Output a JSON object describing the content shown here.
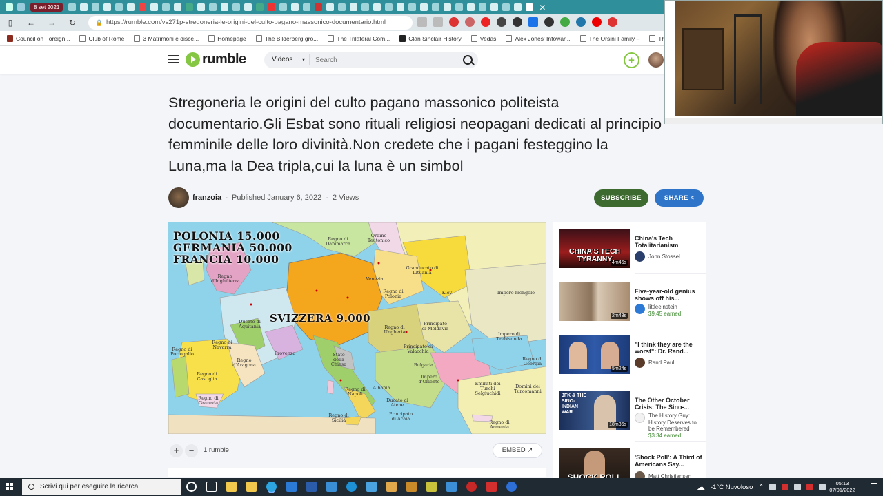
{
  "browser": {
    "active_tab_label": "8 set 2021",
    "url": "https://rumble.com/vs271p-stregoneria-le-origini-del-culto-pagano-massonico-documentario.html",
    "bookmarks": [
      "Council on Foreign...",
      "Club of Rome",
      "3 Matrimoni e disce...",
      "Homepage",
      "The Bilderberg gro...",
      "The Trilateral Com...",
      "Clan Sinclair History",
      "Vedas",
      "Alex Jones' Infowar...",
      "The Orsini Family –",
      "The Coun"
    ]
  },
  "site": {
    "logo_text": "rumble",
    "search_category": "Videos",
    "search_placeholder": "Search",
    "upload_symbol": "+"
  },
  "video": {
    "title": "Stregoneria le origini del culto pagano massonico politeista documentario.Gli Esbat sono rituali religiosi neopagani dedicati al principio femminile delle loro divinità.Non credete che i pagani festeggino la Luna,ma la Dea tripla,cui la luna è un simbol",
    "channel": "franzoia",
    "published": "Published January 6, 2022",
    "views": "2 Views",
    "subscribe_label": "SUBSCRIBE",
    "share_label": "SHARE",
    "rumble_count": "1 rumble",
    "embed_label": "EMBED",
    "frame_caption_lines": [
      "POLONIA 15.000",
      "GERMANIA 50.000",
      "FRANCIA 10.000"
    ],
    "frame_caption_center": "SVIZZERA 9.000",
    "map_labels": [
      "Regno di Danimarca",
      "Ordine Teutonico",
      "Granducato di Lituania",
      "Regno di Polonia",
      "Impero mongolo",
      "Regno di Ungheria",
      "Principato di Moldavia",
      "Principato di Valacchia",
      "Bulgaria",
      "Impero d'Oriente",
      "Emirati dei Turchi Selgiuchidi",
      "Regno di Navarra",
      "Regno di Portogallo",
      "Regno di Castiglia",
      "Regno di Granada",
      "Regno d'Aragona",
      "Provenza",
      "Ducato di Aquitania",
      "Stato della Chiesa",
      "Regno di Napoli",
      "Albania",
      "Regno di Sicilia",
      "Principato di Acaia",
      "Impero di Trebisonda",
      "Regno di Armenia",
      "Ducato di Atene",
      "Domini dei Turcomanni",
      "Regno di Georgia",
      "Kiev",
      "Venezia",
      "Regno d'Inghilterra"
    ]
  },
  "sidebar": {
    "items": [
      {
        "title": "China's Tech Totalitarianism",
        "channel": "John Stossel",
        "earned": "",
        "duration": "4m46s",
        "thumb_text": "CHINA'S TECH TYRANNY"
      },
      {
        "title": "Five-year-old genius shows off his...",
        "channel": "littleeinstein",
        "earned": "$9.45 earned",
        "duration": "2m43s",
        "thumb_text": ""
      },
      {
        "title": "\"I think they are the worst\": Dr. Rand...",
        "channel": "Rand Paul",
        "earned": "",
        "duration": "5m24s",
        "thumb_text": ""
      },
      {
        "title": "The Other October Crisis: The Sino-...",
        "channel": "The History Guy: History Deserves to be Remembered",
        "earned": "$3.34 earned",
        "duration": "18m36s",
        "thumb_text": "JFK & THE SINO-INDIAN WAR"
      },
      {
        "title": "'Shock Poll': A Third of Americans Say...",
        "channel": "Matt Christiansen",
        "earned": "",
        "duration": "",
        "thumb_text": "SHOCK POLL"
      }
    ]
  },
  "taskbar": {
    "search_placeholder": "Scrivi qui per eseguire la ricerca",
    "weather": "-1°C  Nuvoloso",
    "time": "05:13",
    "date": "07/01/2022"
  },
  "colors": {
    "rumble_green": "#85c742",
    "subscribe_green": "#3d6b2f",
    "share_blue": "#2e75c9",
    "tab_teal": "#2f8f9a"
  }
}
